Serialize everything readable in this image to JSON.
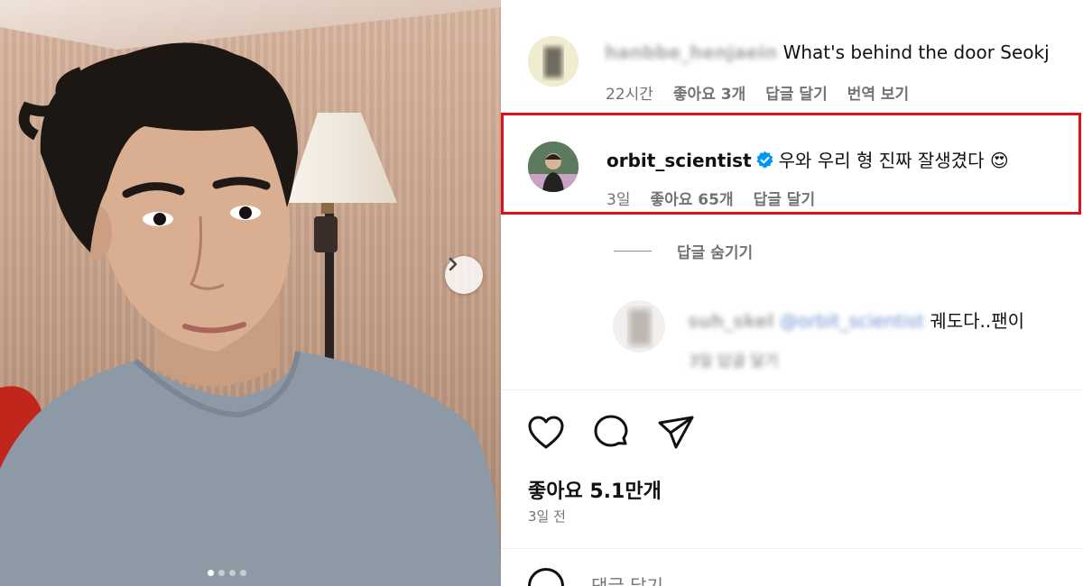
{
  "post_image": {
    "carousel_total": 4,
    "carousel_active": 1
  },
  "comments": [
    {
      "username": "hanbbe_henjaein",
      "text": "What's behind the door Seokj",
      "time": "22시간",
      "likes": "좋아요 3개",
      "reply": "답글 달기",
      "translate": "번역 보기"
    },
    {
      "username": "orbit_scientist",
      "verified": true,
      "text": "우와 우리 형 진짜 잘생겼다",
      "emoji": "😍",
      "time": "3일",
      "likes": "좋아요 65개",
      "reply": "답글 달기"
    }
  ],
  "hide_replies": "답글 숨기기",
  "reply": {
    "username": "suh_skel",
    "mention": "@orbit_scientist",
    "text": "궤도다..팬이",
    "meta": "3일 답글 달기"
  },
  "post": {
    "likes": "좋아요 5.1만개",
    "date": "3일 전"
  },
  "comment_input": {
    "placeholder": "댓글 달기..."
  },
  "icons": [
    "chevron-right-icon",
    "heart-icon",
    "comment-icon",
    "share-icon",
    "verified-icon",
    "emoji-icon"
  ],
  "colors": {
    "highlight": "#e0101a",
    "verified": "#0095f6",
    "meta_text": "#737373"
  }
}
